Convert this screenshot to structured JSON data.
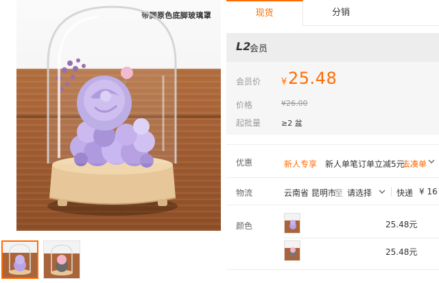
{
  "gallery": {
    "caption": "带脚原色底脚玻璃罩",
    "thumbnails": [
      "purple-rose-thumb",
      "pink-rose-thumb"
    ]
  },
  "tabs": [
    {
      "label": "现货",
      "active": true
    },
    {
      "label": "分销",
      "active": false
    }
  ],
  "member": {
    "level": "L2",
    "level_suffix": "会员"
  },
  "pricing": {
    "member_price_label": "会员价",
    "currency": "¥",
    "member_price": "25.48",
    "price_label": "价格",
    "original_price": "¥26.00",
    "moq_label": "起批量",
    "moq": "≥2 盆"
  },
  "promo": {
    "label": "优惠",
    "tag": "新人专享",
    "text": "新人单笔订单立减5元...",
    "link": "去凑单"
  },
  "logistics": {
    "label": "物流",
    "origin": "云南省 昆明市",
    "to": "至",
    "destination": "请选择",
    "ship_name": "快递",
    "ship_fee": "¥ 16"
  },
  "colors": {
    "label": "颜色",
    "options": [
      {
        "price": "25.48元",
        "swatch": "purple"
      },
      {
        "price": "25.48元",
        "swatch": "pink"
      }
    ]
  },
  "theme": {
    "accent": "#ff6a00",
    "panel_bg": "#f6f6f6",
    "muted": "#999999"
  }
}
